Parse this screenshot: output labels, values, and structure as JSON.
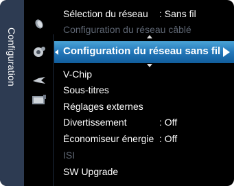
{
  "tab": {
    "label": "Configuration"
  },
  "icons": [
    "satellite-dish-icon",
    "gear-icon",
    "bird-icon",
    "input-panel-icon"
  ],
  "menu": {
    "network_select": {
      "label": "Sélection du réseau",
      "value": ": Sans fil"
    },
    "wired_config": {
      "label": "Configuration du réseau câblé"
    },
    "wireless_config": {
      "label": "Configuration du réseau sans fil"
    },
    "vchip": {
      "label": "V-Chip"
    },
    "subtitles": {
      "label": "Sous-titres"
    },
    "external": {
      "label": "Réglages externes"
    },
    "entertainment": {
      "label": "Divertissement",
      "value": ": Off"
    },
    "energy": {
      "label": "Économiseur énergie",
      "value": ": Off"
    },
    "isi": {
      "label": "ISI"
    },
    "sw_upgrade": {
      "label": "SW Upgrade"
    }
  },
  "colors": {
    "highlight": "#2377b9",
    "tab": "#2d3b52",
    "disabled": "#5e6673"
  }
}
